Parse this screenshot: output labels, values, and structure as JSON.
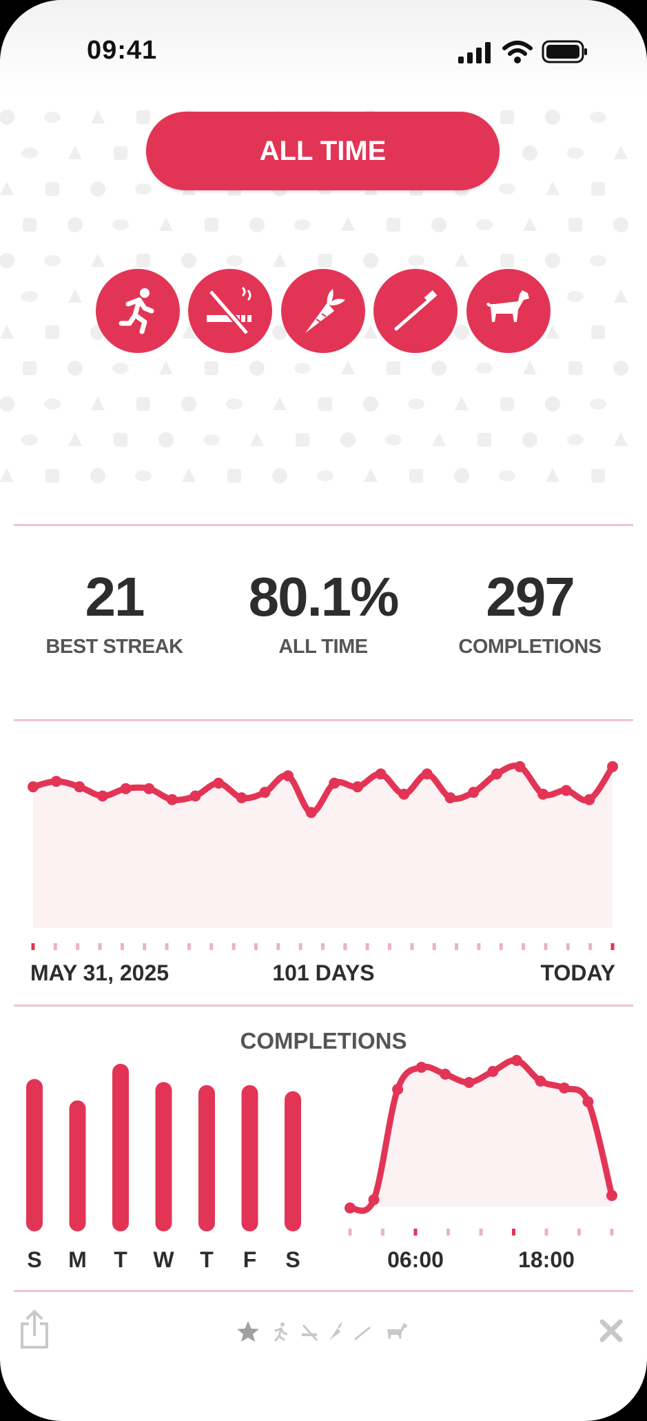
{
  "status_bar": {
    "time": "09:41"
  },
  "range_button": {
    "label": "ALL TIME"
  },
  "habits": [
    {
      "icon": "running-icon"
    },
    {
      "icon": "no-smoking-icon"
    },
    {
      "icon": "carrot-icon"
    },
    {
      "icon": "toothbrush-icon"
    },
    {
      "icon": "dog-icon"
    }
  ],
  "stats": [
    {
      "value": "21",
      "label": "BEST STREAK"
    },
    {
      "value": "80.1%",
      "label": "ALL TIME"
    },
    {
      "value": "297",
      "label": "COMPLETIONS"
    }
  ],
  "trend": {
    "start_label": "MAY 31, 2025",
    "span_label": "101 DAYS",
    "end_label": "TODAY"
  },
  "completions": {
    "title": "COMPLETIONS",
    "hour_labels": [
      "06:00",
      "18:00"
    ]
  },
  "chart_data": [
    {
      "type": "area",
      "x_labels": [
        "MAY 31, 2025",
        "101 DAYS",
        "TODAY"
      ],
      "values": [
        0.77,
        0.8,
        0.77,
        0.72,
        0.76,
        0.76,
        0.7,
        0.72,
        0.79,
        0.71,
        0.74,
        0.83,
        0.63,
        0.79,
        0.77,
        0.84,
        0.73,
        0.84,
        0.71,
        0.74,
        0.84,
        0.88,
        0.73,
        0.75,
        0.7,
        0.88
      ],
      "ylim": [
        0,
        1
      ],
      "grid": false
    },
    {
      "type": "bar",
      "categories": [
        "S",
        "M",
        "T",
        "W",
        "T",
        "F",
        "S"
      ],
      "values": [
        1.0,
        0.86,
        1.1,
        0.98,
        0.96,
        0.96,
        0.92
      ]
    },
    {
      "type": "area",
      "x_labels": [
        "06:00",
        "18:00"
      ],
      "values": [
        0.04,
        0.1,
        0.9,
        1.06,
        1.01,
        0.95,
        1.03,
        1.11,
        0.96,
        0.91,
        0.81,
        0.13
      ],
      "grid": false
    }
  ]
}
